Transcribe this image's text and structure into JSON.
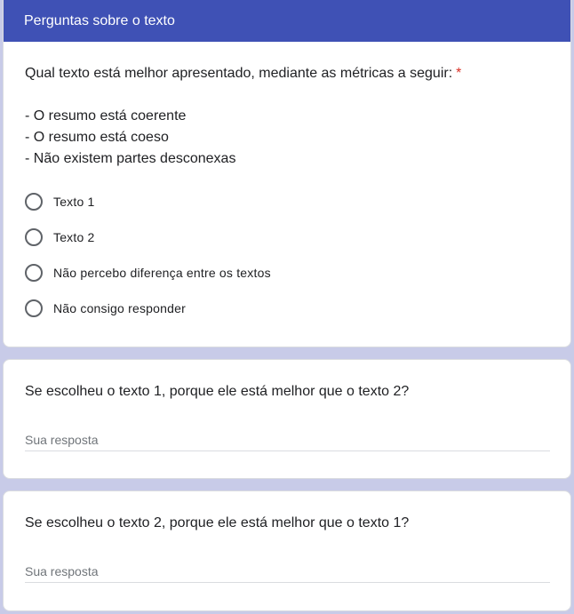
{
  "section": {
    "title": "Perguntas sobre o texto"
  },
  "question1": {
    "title": "Qual texto está melhor apresentado, mediante as métricas a seguir:",
    "required_mark": "*",
    "description": [
      "- O resumo está coerente",
      "- O resumo está coeso",
      "- Não existem partes desconexas"
    ],
    "options": [
      "Texto 1",
      "Texto 2",
      "Não percebo diferença entre os textos",
      "Não consigo responder"
    ]
  },
  "question2": {
    "title": "Se escolheu o texto 1, porque ele está melhor que o texto 2?",
    "placeholder": "Sua resposta"
  },
  "question3": {
    "title": "Se escolheu o texto 2, porque ele está melhor que o texto 1?",
    "placeholder": "Sua resposta"
  },
  "colors": {
    "header_bg": "#3f51b5",
    "page_bg": "#c8cbe8",
    "required": "#d93025"
  }
}
